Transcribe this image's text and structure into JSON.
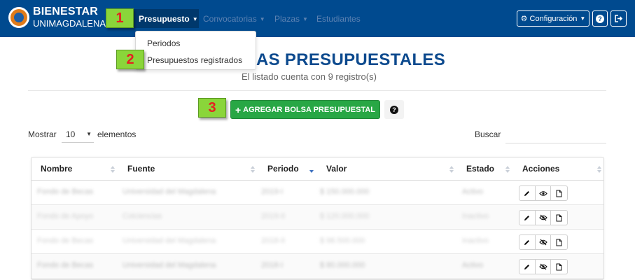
{
  "brand": {
    "title": "BIENESTAR",
    "subtitle": "UNIMAGDALENA"
  },
  "nav": {
    "items": [
      {
        "label": "Presupuesto",
        "active": true
      },
      {
        "label": "Convocatorias",
        "active": false
      },
      {
        "label": "Plazas",
        "active": false
      },
      {
        "label": "Estudiantes",
        "active": false
      }
    ],
    "config_label": "Configuración"
  },
  "dropdown": {
    "items": [
      "Periodos",
      "Presupuestos registrados"
    ]
  },
  "steps": [
    "1",
    "2",
    "3"
  ],
  "page": {
    "title": "AS PRESUPUESTALES",
    "subtitle": "El listado cuenta con 9 registro(s)",
    "add_button": "AGREGAR BOLSA PRESUPUESTAL"
  },
  "table_controls": {
    "show_label": "Mostrar",
    "show_value": "10",
    "show_suffix": "elementos",
    "search_label": "Buscar"
  },
  "table": {
    "columns": [
      "Nombre",
      "Fuente",
      "Periodo",
      "Valor",
      "Estado",
      "Acciones"
    ],
    "rows": [
      [
        "Fondo de Becas",
        "Universidad del Magdalena",
        "2019-I",
        "$ 150.000.000",
        "Activo"
      ],
      [
        "Fondo de Apoyo",
        "Colciencias",
        "2019-II",
        "$ 120.000.000",
        "Inactivo"
      ],
      [
        "Fondo de Becas",
        "Universidad del Magdalena",
        "2018-II",
        "$ 98.500.000",
        "Inactivo"
      ],
      [
        "Fondo de Becas",
        "Universidad del Magdalena",
        "2018-I",
        "$ 80.000.000",
        "Activo"
      ]
    ]
  },
  "colors": {
    "navbar": "#004a8f",
    "accent_green": "#28a745",
    "title_blue": "#0d4a8e",
    "step_badge": "#8ad53a",
    "step_number": "#e52020"
  }
}
